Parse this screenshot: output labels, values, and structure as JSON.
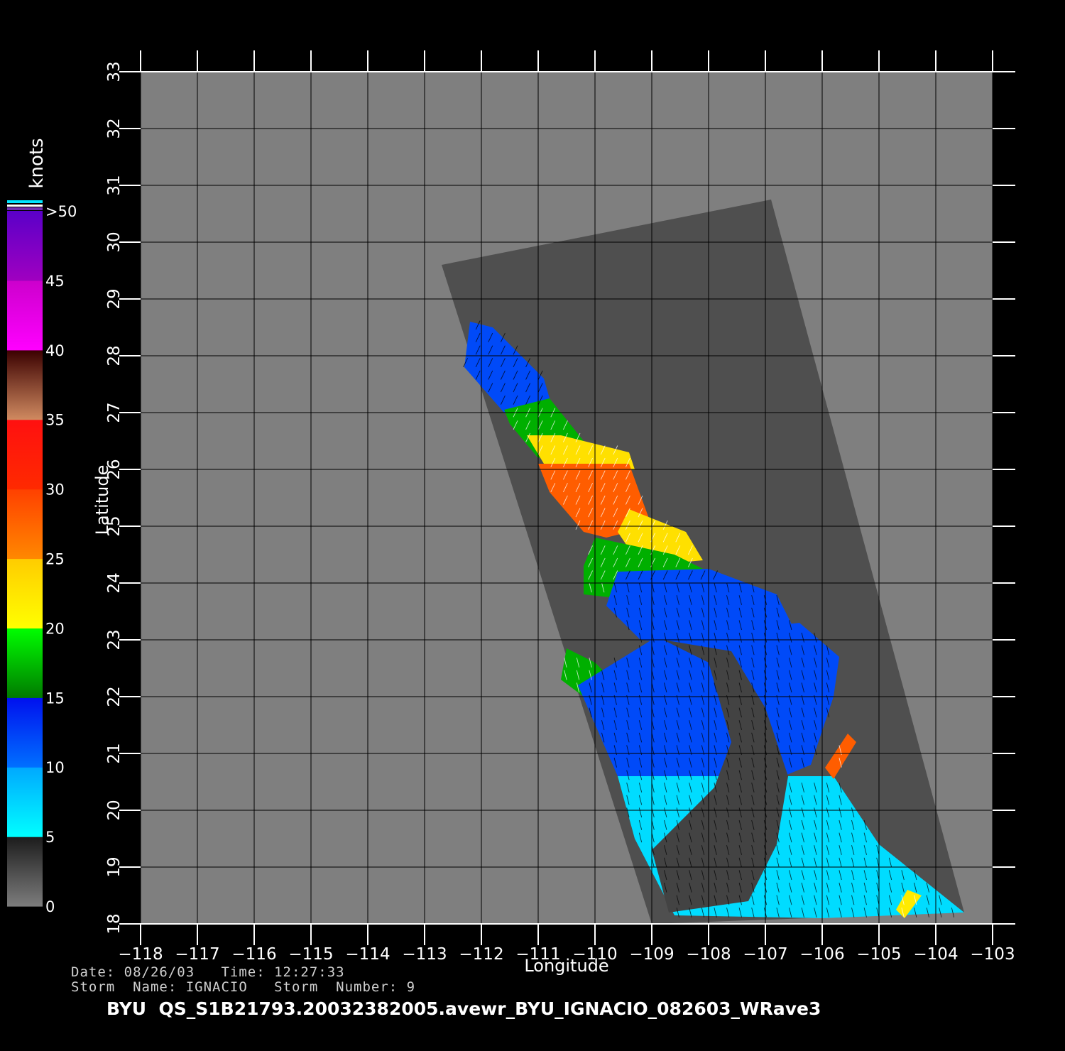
{
  "chart_data": {
    "type": "heatmap",
    "title": "",
    "xlabel": "Longitude",
    "ylabel": "Latitude",
    "xlim": [
      -118,
      -103
    ],
    "ylim": [
      18,
      33
    ],
    "x_ticks": [
      -118,
      -117,
      -116,
      -115,
      -114,
      -113,
      -112,
      -111,
      -110,
      -109,
      -108,
      -107,
      -106,
      -105,
      -104,
      -103
    ],
    "y_ticks": [
      18,
      19,
      20,
      21,
      22,
      23,
      24,
      25,
      26,
      27,
      28,
      29,
      30,
      31,
      32,
      33
    ],
    "x_tick_labels": [
      "−118",
      "−117",
      "−116",
      "−115",
      "−114",
      "−113",
      "−112",
      "−111",
      "−110",
      "−109",
      "−108",
      "−107",
      "−106",
      "−105",
      "−104",
      "−103"
    ],
    "y_tick_labels": [
      "18",
      "19",
      "20",
      "21",
      "22",
      "23",
      "24",
      "25",
      "26",
      "27",
      "28",
      "29",
      "30",
      "31",
      "32",
      "33"
    ],
    "grid": true,
    "colorbar": {
      "unit": "knots",
      "placement": "left",
      "tick_labels": [
        "0",
        "5",
        "10",
        "15",
        "20",
        "25",
        "30",
        "35",
        "40",
        "45",
        ">50"
      ],
      "bands": [
        {
          "from": 0,
          "to": 5,
          "colors": [
            "#7d7d7d",
            "#1c1c1c"
          ]
        },
        {
          "from": 5,
          "to": 10,
          "colors": [
            "#00ffff",
            "#00a8ff"
          ]
        },
        {
          "from": 10,
          "to": 15,
          "colors": [
            "#0070ff",
            "#0010ee"
          ]
        },
        {
          "from": 15,
          "to": 20,
          "colors": [
            "#007a00",
            "#00ff00"
          ]
        },
        {
          "from": 20,
          "to": 25,
          "colors": [
            "#ffff00",
            "#ffcc00"
          ]
        },
        {
          "from": 25,
          "to": 30,
          "colors": [
            "#ff8800",
            "#ff4000"
          ]
        },
        {
          "from": 30,
          "to": 35,
          "colors": [
            "#ff2a00",
            "#ff1010"
          ]
        },
        {
          "from": 35,
          "to": 40,
          "colors": [
            "#d08a60",
            "#3a0000"
          ]
        },
        {
          "from": 40,
          "to": 45,
          "colors": [
            "#ff00ff",
            "#cc00cc"
          ]
        },
        {
          "from": 45,
          "to": 50,
          "colors": [
            "#a000c0",
            "#5a00c8"
          ]
        }
      ]
    },
    "swath_outline": [
      [
        -112.7,
        29.6
      ],
      [
        -106.9,
        30.75
      ],
      [
        -103.5,
        18.2
      ],
      [
        -109.0,
        18.0
      ]
    ],
    "wind_regions": [
      {
        "speed": 12,
        "polygon": [
          [
            -112.2,
            28.6
          ],
          [
            -111.8,
            28.5
          ],
          [
            -110.9,
            27.6
          ],
          [
            -110.8,
            27.25
          ],
          [
            -111.6,
            27.0
          ],
          [
            -112.3,
            27.8
          ]
        ]
      },
      {
        "speed": 17,
        "polygon": [
          [
            -111.6,
            27.05
          ],
          [
            -110.8,
            27.25
          ],
          [
            -110.2,
            26.5
          ],
          [
            -111.0,
            26.2
          ],
          [
            -111.5,
            26.8
          ]
        ]
      },
      {
        "speed": 23,
        "polygon": [
          [
            -111.2,
            26.6
          ],
          [
            -110.6,
            26.6
          ],
          [
            -109.4,
            26.3
          ],
          [
            -109.3,
            26.0
          ],
          [
            -110.4,
            25.9
          ],
          [
            -110.9,
            26.1
          ]
        ]
      },
      {
        "speed": 28,
        "polygon": [
          [
            -111.0,
            26.1
          ],
          [
            -109.4,
            26.1
          ],
          [
            -109.0,
            25.0
          ],
          [
            -109.8,
            24.8
          ],
          [
            -110.2,
            24.9
          ],
          [
            -110.8,
            25.6
          ]
        ]
      },
      {
        "speed": 23,
        "polygon": [
          [
            -109.4,
            25.3
          ],
          [
            -108.4,
            24.9
          ],
          [
            -108.1,
            24.4
          ],
          [
            -109.2,
            24.3
          ],
          [
            -109.6,
            24.9
          ]
        ]
      },
      {
        "speed": 17,
        "polygon": [
          [
            -110.0,
            24.8
          ],
          [
            -108.6,
            24.5
          ],
          [
            -108.0,
            24.2
          ],
          [
            -109.3,
            23.7
          ],
          [
            -110.2,
            23.8
          ],
          [
            -110.2,
            24.3
          ]
        ]
      },
      {
        "speed": 17,
        "polygon": [
          [
            -110.5,
            22.85
          ],
          [
            -110.0,
            22.6
          ],
          [
            -109.8,
            22.4
          ],
          [
            -110.2,
            22.0
          ],
          [
            -110.6,
            22.3
          ]
        ]
      },
      {
        "speed": 12,
        "polygon": [
          [
            -109.6,
            24.2
          ],
          [
            -108.0,
            24.25
          ],
          [
            -106.8,
            23.8
          ],
          [
            -106.5,
            23.2
          ],
          [
            -107.4,
            22.8
          ],
          [
            -109.2,
            23.0
          ],
          [
            -109.8,
            23.6
          ]
        ]
      },
      {
        "speed": 12,
        "polygon": [
          [
            -110.3,
            22.2
          ],
          [
            -109.0,
            23.0
          ],
          [
            -106.4,
            23.3
          ],
          [
            -105.7,
            22.7
          ],
          [
            -105.8,
            22.0
          ],
          [
            -106.2,
            20.8
          ],
          [
            -107.4,
            20.3
          ],
          [
            -109.0,
            19.8
          ],
          [
            -109.6,
            20.6
          ]
        ]
      },
      {
        "speed": 7,
        "polygon": [
          [
            -109.6,
            20.6
          ],
          [
            -107.0,
            20.6
          ],
          [
            -105.8,
            20.6
          ],
          [
            -105.0,
            19.4
          ],
          [
            -103.5,
            18.2
          ],
          [
            -106.0,
            18.1
          ],
          [
            -108.6,
            18.15
          ],
          [
            -109.3,
            19.5
          ]
        ]
      },
      {
        "speed": 3,
        "polygon": [
          [
            -108.8,
            23.0
          ],
          [
            -108.0,
            22.6
          ],
          [
            -107.6,
            21.2
          ],
          [
            -107.9,
            20.4
          ],
          [
            -109.0,
            19.3
          ],
          [
            -108.7,
            18.2
          ],
          [
            -107.3,
            18.4
          ],
          [
            -106.8,
            19.4
          ],
          [
            -106.6,
            20.6
          ],
          [
            -107.0,
            21.8
          ],
          [
            -107.6,
            22.8
          ]
        ]
      },
      {
        "speed": 28,
        "polygon": [
          [
            -105.55,
            21.35
          ],
          [
            -105.4,
            21.2
          ],
          [
            -105.8,
            20.55
          ],
          [
            -105.95,
            20.75
          ]
        ]
      },
      {
        "speed": 22,
        "polygon": [
          [
            -104.5,
            18.6
          ],
          [
            -104.25,
            18.5
          ],
          [
            -104.55,
            18.1
          ],
          [
            -104.7,
            18.25
          ]
        ]
      }
    ]
  },
  "footer": {
    "line1": "Date: 08/26/03   Time: 12:27:33",
    "line2": "Storm  Name: IGNACIO   Storm  Number: 9",
    "title": "BYU  QS_S1B21793.20032382005.avewr_BYU_IGNACIO_082603_WRave3"
  }
}
